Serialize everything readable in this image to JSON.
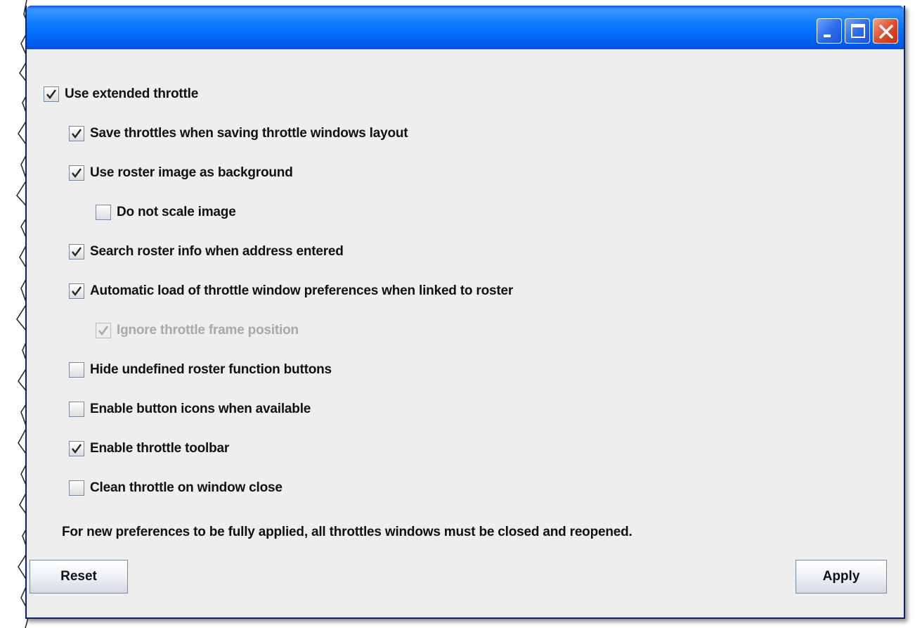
{
  "window": {
    "controls": {
      "minimize": "minimize-icon",
      "maximize": "maximize-icon",
      "close": "close-icon"
    },
    "colors": {
      "titlebar": "#0054e3",
      "close_button": "#e05030",
      "background": "#eeeeee",
      "disabled_text": "#a8a8a8"
    }
  },
  "options": [
    {
      "label": "Use extended throttle",
      "checked": true,
      "enabled": true
    },
    {
      "label": "Save throttles when saving throttle windows layout",
      "checked": true,
      "enabled": true
    },
    {
      "label": "Use roster image as background",
      "checked": true,
      "enabled": true
    },
    {
      "label": "Do not scale image",
      "checked": false,
      "enabled": true
    },
    {
      "label": "Search roster info when address entered",
      "checked": true,
      "enabled": true
    },
    {
      "label": "Automatic load of throttle window preferences when linked to roster",
      "checked": true,
      "enabled": true
    },
    {
      "label": "Ignore throttle frame position",
      "checked": true,
      "enabled": false
    },
    {
      "label": "Hide undefined roster function buttons",
      "checked": false,
      "enabled": true
    },
    {
      "label": "Enable button icons when available",
      "checked": false,
      "enabled": true
    },
    {
      "label": "Enable throttle toolbar",
      "checked": true,
      "enabled": true
    },
    {
      "label": "Clean throttle on window close",
      "checked": false,
      "enabled": true
    }
  ],
  "note": "For new preferences to be fully applied, all throttles windows must be closed and reopened.",
  "buttons": {
    "reset": "Reset",
    "apply": "Apply"
  }
}
